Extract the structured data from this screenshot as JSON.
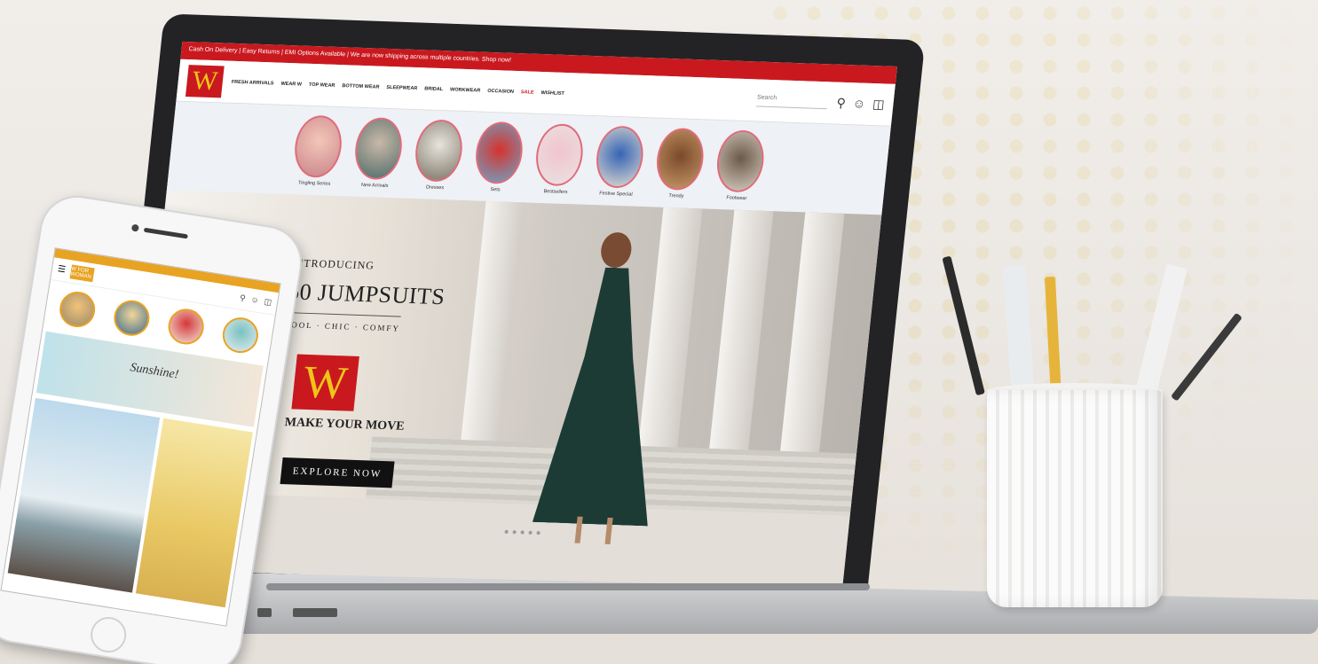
{
  "website": {
    "announcement": "Cash On Delivery | Easy Returns | EMI Options Available | We are now shipping across multiple countries. Shop now!",
    "logo_letter": "W",
    "nav_links": [
      "FRESH ARRIVALS",
      "WEAR W",
      "TOP WEAR",
      "BOTTOM WEAR",
      "SLEEPWEAR",
      "BRIDAL",
      "WORKWEAR",
      "OCCASION",
      "SALE",
      "WISHLIST"
    ],
    "search_placeholder": "Search",
    "stories": [
      "Tingling Series",
      "New Arrivals",
      "Dresses",
      "Sets",
      "Bestsellers",
      "Festive Special",
      "Trendy",
      "Footwear"
    ],
    "hero": {
      "intro": "INTRODUCING",
      "headline": "60 JUMPSUITS",
      "tagline": "COOL · CHIC · COMFY",
      "slogan": "MAKE YOUR MOVE",
      "cta": "EXPLORE NOW"
    }
  },
  "phone": {
    "logo": "W FOR WOMAN",
    "banner_script": "Sunshine!"
  },
  "colors": {
    "brand_red": "#c9191f",
    "brand_gold": "#f0c419",
    "phone_accent": "#e8a322"
  }
}
